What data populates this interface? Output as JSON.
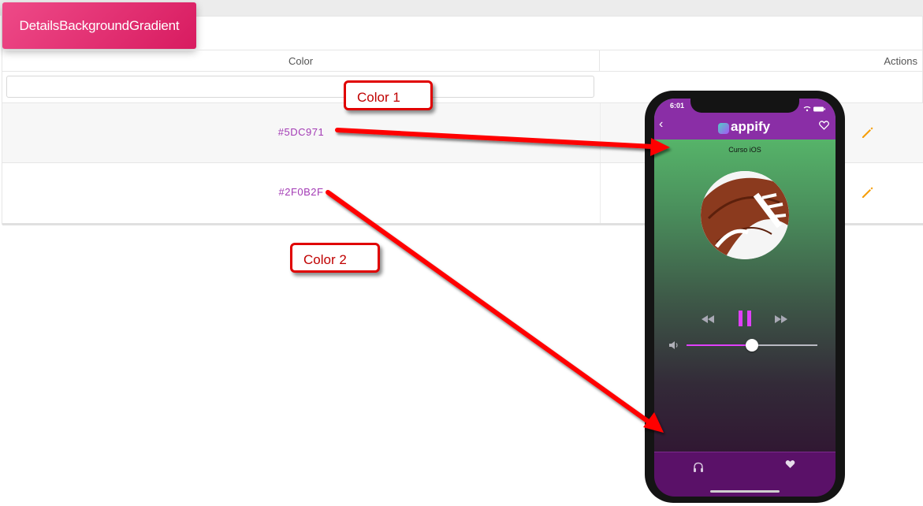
{
  "page": {
    "title": "DetailsBackgroundGradient"
  },
  "table": {
    "columns": [
      "Color",
      "Actions"
    ],
    "filter_placeholder": "",
    "rows": [
      {
        "color": "#5DC971"
      },
      {
        "color": "#2F0B2F"
      }
    ]
  },
  "callouts": {
    "color1": "Color 1",
    "color2": "Color 2"
  },
  "phone": {
    "time": "6:01",
    "app_name": "appify",
    "track_title": "Curso iOS",
    "volume_level": 0.5,
    "gradient_start": "#5DC971",
    "gradient_end": "#2F0B2F"
  },
  "colors": {
    "title_badge": "#d81b60",
    "color_text": "#a33bb5",
    "edit_icon": "#f59e0b",
    "arrow": "#ff0000",
    "phone_header": "#8a2ea6",
    "phone_tabbar": "#5a1168",
    "play_accent": "#e040fb"
  },
  "icons": [
    "edit-icon",
    "back-chevron-icon",
    "heart-icon",
    "rewind-icon",
    "pause-icon",
    "fast-forward-icon",
    "volume-icon",
    "headphones-icon",
    "wifi-icon",
    "battery-icon"
  ]
}
